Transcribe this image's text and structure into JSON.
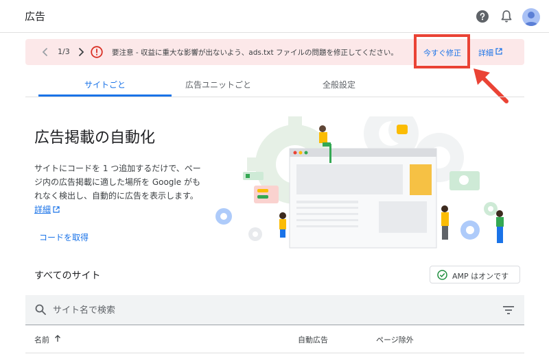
{
  "header": {
    "app_title": "広告",
    "icons": [
      "help-icon",
      "notifications-bell-icon",
      "account-avatar"
    ]
  },
  "alert": {
    "counter": "1/3",
    "message": "要注意 - 収益に重大な影響が出ないよう、ads.txt ファイルの問題を修正してください。",
    "fix_label": "今すぐ修正",
    "details_label": "詳細",
    "colors": {
      "background": "#fce8e9",
      "error": "#d93025",
      "highlight": "#ea4335"
    }
  },
  "tabs": [
    {
      "label": "サイトごと",
      "active": true
    },
    {
      "label": "広告ユニットごと",
      "active": false
    },
    {
      "label": "全般設定",
      "active": false
    }
  ],
  "promo": {
    "title": "広告掲載の自動化",
    "description": "サイトにコードを 1 つ追加するだけで、ページ内の広告掲載に適した場所を Google がもれなく検出し、自動的に広告を表示します。",
    "details_link": "詳細",
    "get_code": "コードを取得"
  },
  "sites": {
    "title": "すべてのサイト",
    "amp_status": "AMP はオンです",
    "search_placeholder": "サイト名で検索",
    "columns": [
      "名前",
      "自動広告",
      "ページ除外"
    ]
  },
  "accent_color": "#1a73e8"
}
